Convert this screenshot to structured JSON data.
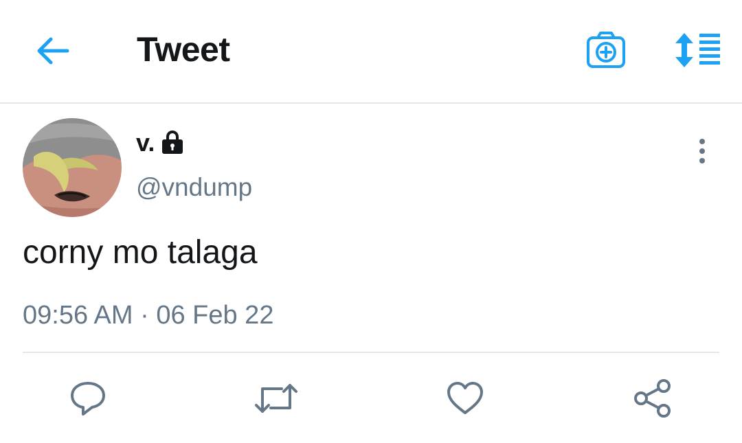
{
  "header": {
    "title": "Tweet",
    "back_icon": "arrow-left-icon",
    "camera_icon": "camera-add-icon",
    "sort_icon": "sort-list-icon",
    "accent_color": "#1da1f2"
  },
  "tweet": {
    "display_name": "v.",
    "protected_icon": "lock-icon",
    "handle": "@vndump",
    "text": "corny mo talaga",
    "timestamp": "09:56 AM · 06 Feb 22",
    "more_icon": "more-vertical-icon"
  },
  "actions": {
    "reply_icon": "reply-icon",
    "retweet_icon": "retweet-icon",
    "like_icon": "heart-icon",
    "share_icon": "share-icon",
    "icon_color": "#657786"
  }
}
